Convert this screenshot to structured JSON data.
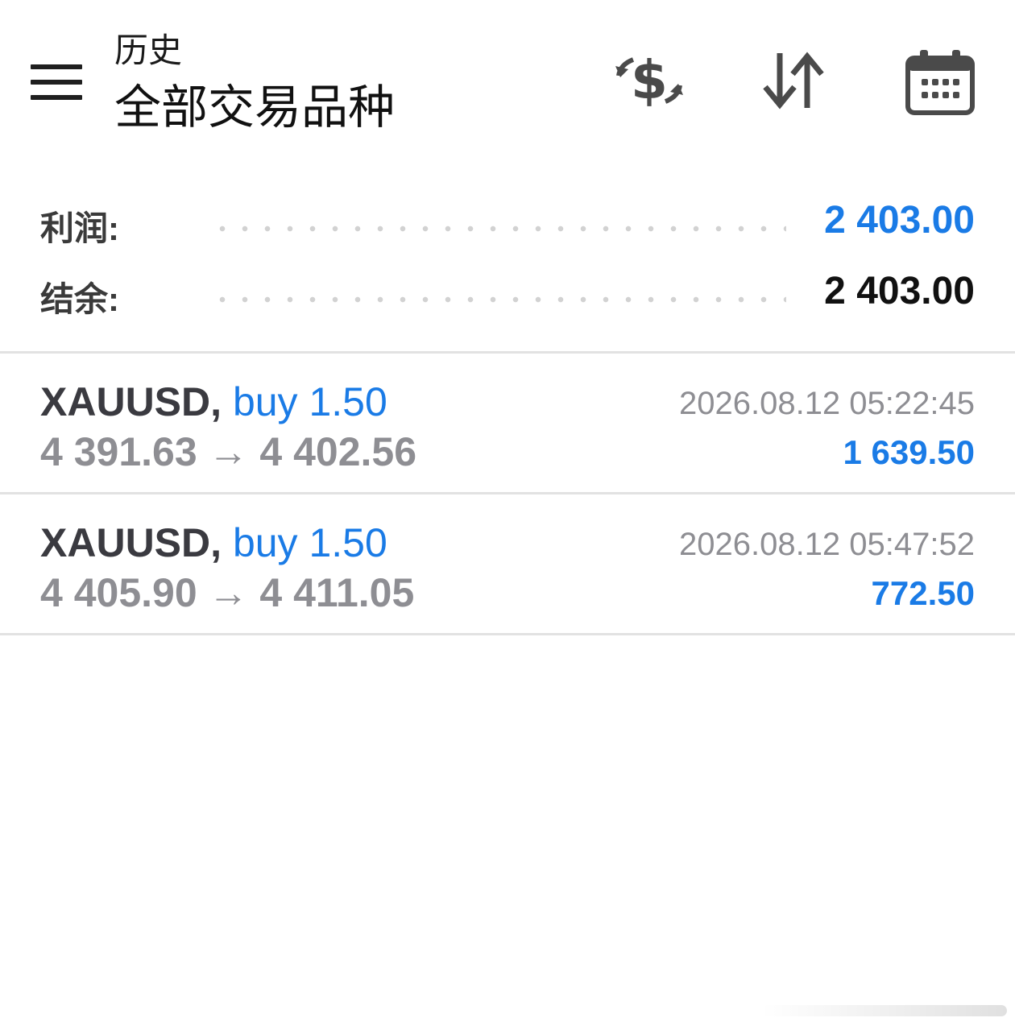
{
  "header": {
    "title_small": "历史",
    "title_big": "全部交易品种",
    "icons": [
      "menu-icon",
      "currency-exchange-icon",
      "sort-icon",
      "calendar-icon"
    ]
  },
  "summary": {
    "profit_label": "利润:",
    "profit_value": "2 403.00",
    "balance_label": "结余:",
    "balance_value": "2 403.00"
  },
  "deals": [
    {
      "symbol": "XAUUSD,",
      "side": "buy 1.50",
      "prices": "4 391.63 → 4 402.56",
      "time": "2026.08.12 05:22:45",
      "profit": "1 639.50"
    },
    {
      "symbol": "XAUUSD,",
      "side": "buy 1.50",
      "prices": "4 405.90 → 4 411.05",
      "time": "2026.08.12 05:47:52",
      "profit": "772.50"
    }
  ],
  "colors": {
    "accent_blue": "#1a7be6",
    "text_gray": "#8e8e93",
    "icon_dark": "#4a4a4a"
  }
}
